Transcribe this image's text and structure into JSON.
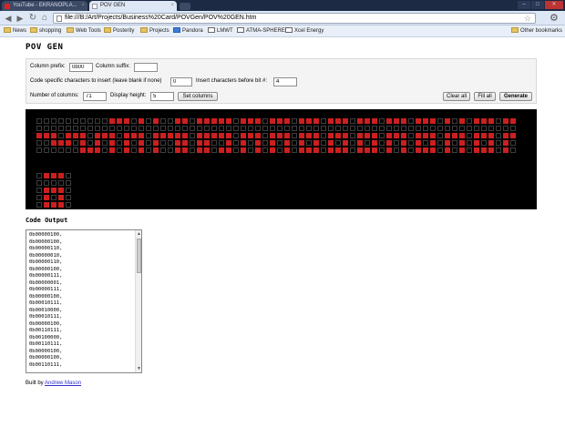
{
  "browser": {
    "tabs": [
      {
        "label": "YouTube - EKRANOPLA..."
      },
      {
        "label": "POV GEN"
      }
    ],
    "url": "file:///B:/Art/Projects/Business%20Card/POVGen/POV%20GEN.htm",
    "bookmarks": [
      "News",
      "shopping",
      "Web Tools",
      "Posterity",
      "Projects",
      "Pandora",
      "LMWT",
      "ATMA-SPHERE",
      "Xcel Energy"
    ],
    "other_bookmarks": "Other bookmarks"
  },
  "page": {
    "title": "POV GEN",
    "controls": {
      "column_prefix_label": "Column prefix:",
      "column_prefix_value": "0b00",
      "column_suffix_label": "Column suffix:",
      "column_suffix_value": "",
      "code_specific_label": "Code specific characters to insert (leave blank if none)",
      "code_specific_value": "0",
      "insert_before_bit_label": "Insert characters before bit #:",
      "insert_before_bit_value": "4",
      "num_columns_label": "Number of columns:",
      "num_columns_value": "71",
      "display_height_label": "Display height:",
      "display_height_value": "5",
      "set_columns_label": "Set columns",
      "clear_all_label": "Clear all",
      "fill_all_label": "Fill all",
      "generate_label": "Generate"
    },
    "grid": {
      "on_color": "#cc1f1f",
      "off_color": "#000000",
      "rows": 5,
      "columns": 71,
      "columns_per_line": 66,
      "values": [
        "0b00000100",
        "0b00000100",
        "0b00000110",
        "0b00000010",
        "0b00000110",
        "0b00000100",
        "0b00000111",
        "0b00000001",
        "0b00000111",
        "0b00000100",
        "0b00010111",
        "0b00010000",
        "0b00010111",
        "0b00000100",
        "0b00110111",
        "0b00100000",
        "0b00110111",
        "0b00000100",
        "0b00000100",
        "0b00110111",
        "0b00010111",
        "0b00000000",
        "0b00010111",
        "0b00010111",
        "0b00110100",
        "0b00010101",
        "0b00010111",
        "0b00000000",
        "0b00010111",
        "0b00110100",
        "0b00010111",
        "0b00000000",
        "0b00110111",
        "0b00110100",
        "0b00110111",
        "0b00000000",
        "0b00110111",
        "0b00010101",
        "0b00010111",
        "0b00000000",
        "0b00110111",
        "0b00110101",
        "0b00010111",
        "0b00000000",
        "0b00110111",
        "0b00010101",
        "0b00110111",
        "0b00000000",
        "0b00110111",
        "0b00010100",
        "0b00110111",
        "0b00000000",
        "0b00110111",
        "0b00010101",
        "0b00010111",
        "0b00000000",
        "0b00110111",
        "0b00100100",
        "0b00110111",
        "0b00000000",
        "0b00110111",
        "0b00010101",
        "0b00110111",
        "0b00000000",
        "0b00010111",
        "0b00010100",
        "0b00000000",
        "0b00110111",
        "0b00010101",
        "0b00010111",
        "0b00000000"
      ]
    },
    "code_output_title": "Code Output",
    "code_output": [
      "0b00000100,",
      "0b00000100,",
      "0b00000110,",
      "0b00000010,",
      "0b00000110,",
      "0b00000100,",
      "0b00000111,",
      "0b00000001,",
      "0b00000111,",
      "0b00000100,",
      "0b00010111,",
      "0b00010000,",
      "0b00010111,",
      "0b00000100,",
      "0b00110111,",
      "0b00100000,",
      "0b00110111,",
      "0b00000100,",
      "0b00000100,",
      "0b00110111,"
    ],
    "footer_prefix": "Built by",
    "footer_link": "Andrew Mason"
  }
}
